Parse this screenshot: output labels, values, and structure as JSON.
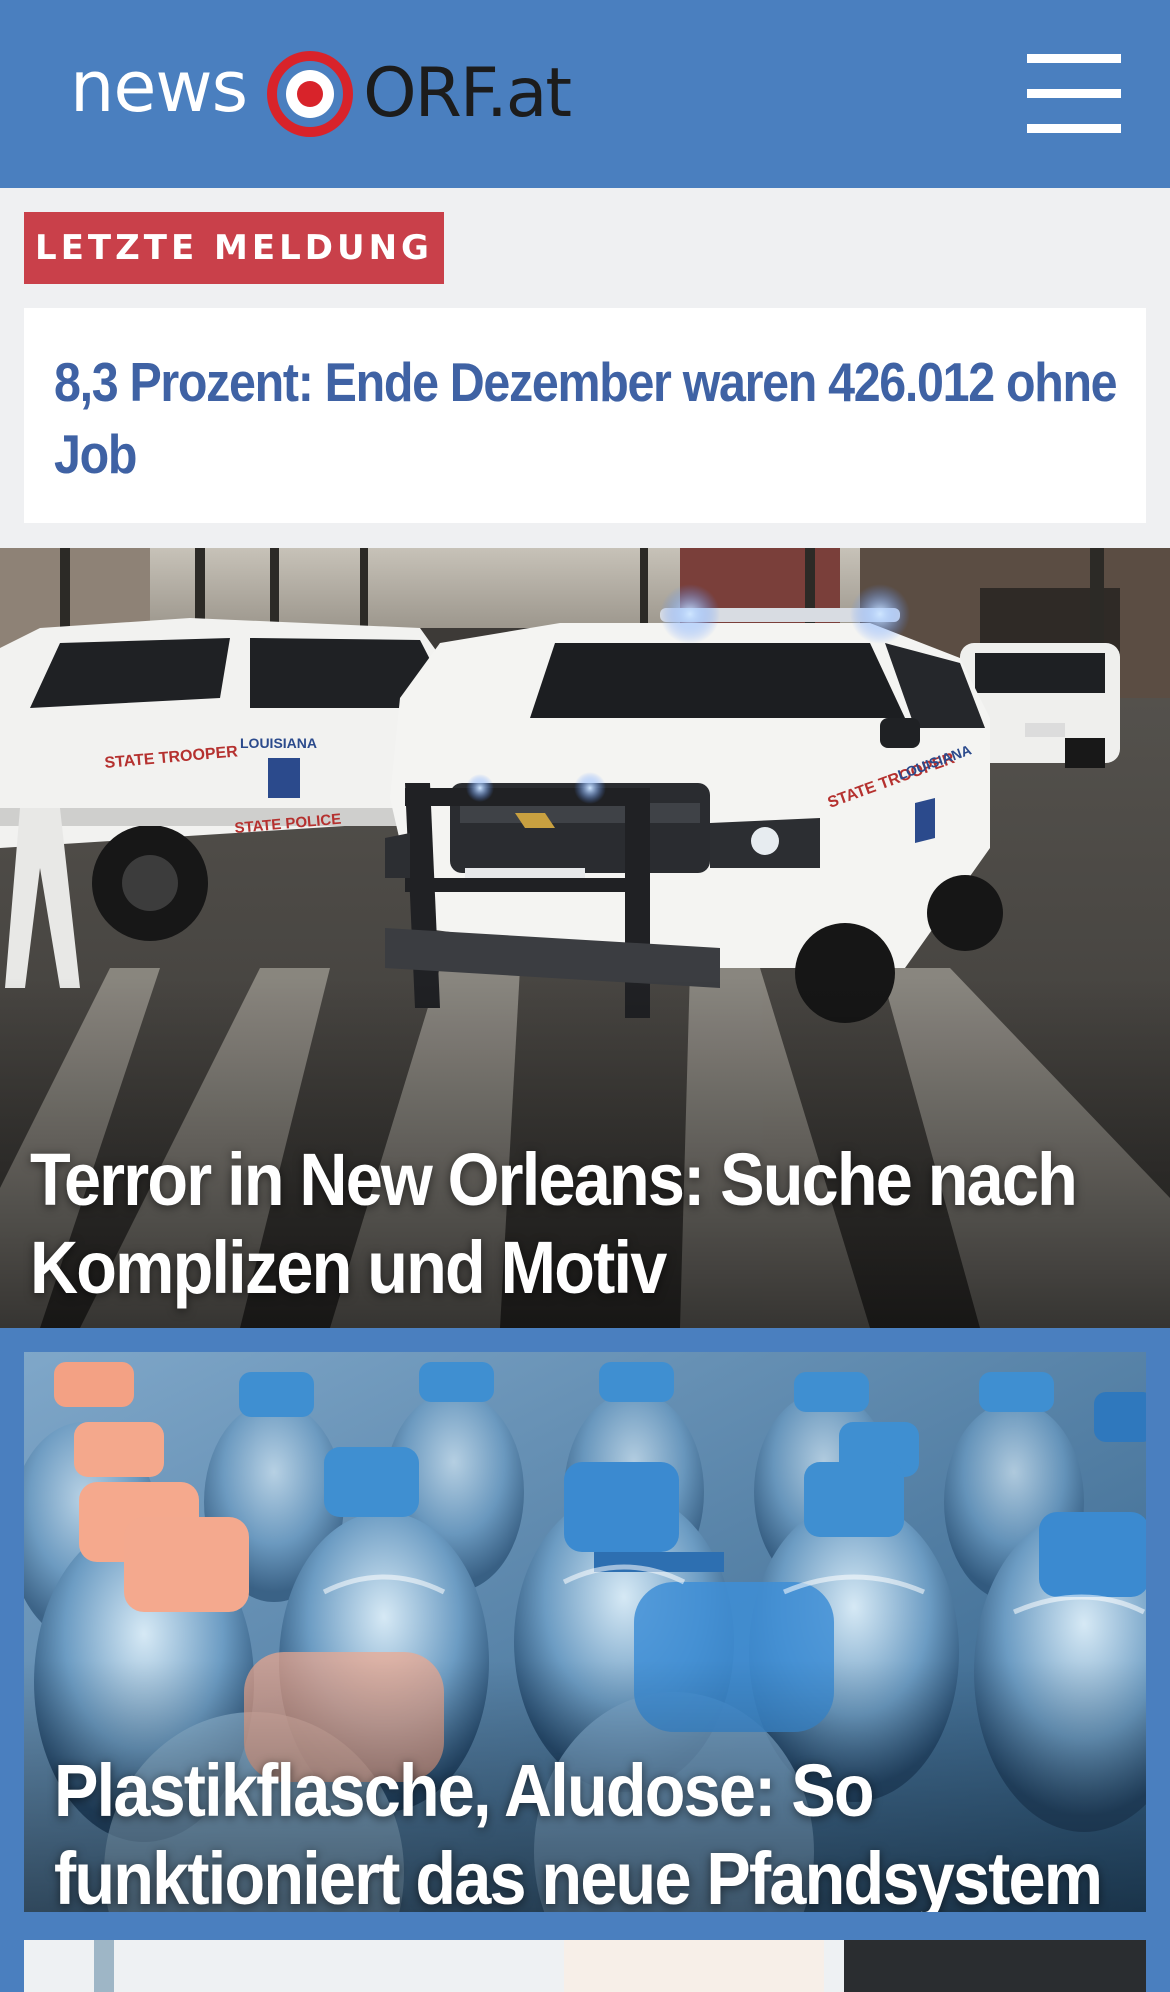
{
  "header": {
    "logo_news": "news",
    "logo_orf": "ORF.at",
    "menu_icon": "hamburger-menu-icon",
    "background_color": "#4a7fbf"
  },
  "breaking": {
    "tag_label": "LETZTE MELDUNG",
    "headline": "8,3 Prozent: Ende Dezember waren 426.012 ohne Job",
    "tag_color": "#c9404a",
    "headline_color": "#3f62a4"
  },
  "stories": [
    {
      "title": "Terror in New Orleans: Suche nach Komplizen und Motiv"
    },
    {
      "title": "Plastikflasche, Aludose: So funktioniert das neue Pfandsystem"
    }
  ]
}
